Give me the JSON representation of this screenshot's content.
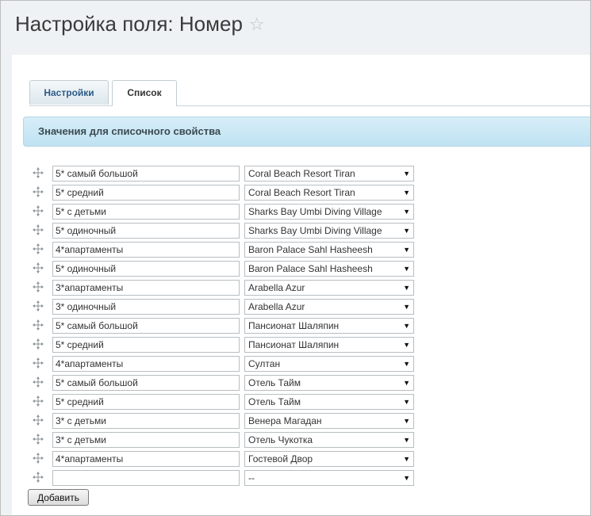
{
  "page": {
    "title": "Настройка поля: Номер"
  },
  "tabs": [
    {
      "label": "Настройки",
      "active": false
    },
    {
      "label": "Список",
      "active": true
    }
  ],
  "section": {
    "title": "Значения для списочного свойства"
  },
  "rows": [
    {
      "value": "5* самый большой",
      "hotel": "Coral Beach Resort Tiran"
    },
    {
      "value": "5* средний",
      "hotel": "Coral Beach Resort Tiran"
    },
    {
      "value": "5* с детьми",
      "hotel": "Sharks Bay Umbi Diving Village"
    },
    {
      "value": "5* одиночный",
      "hotel": "Sharks Bay Umbi Diving Village"
    },
    {
      "value": "4*апартаменты",
      "hotel": "Baron Palace Sahl Hasheesh"
    },
    {
      "value": "5* одиночный",
      "hotel": "Baron Palace Sahl Hasheesh"
    },
    {
      "value": "3*апартаменты",
      "hotel": "Arabella Azur"
    },
    {
      "value": "3* одиночный",
      "hotel": "Arabella Azur"
    },
    {
      "value": "5* самый большой",
      "hotel": "Пансионат Шаляпин"
    },
    {
      "value": "5* средний",
      "hotel": "Пансионат Шаляпин"
    },
    {
      "value": "4*апартаменты",
      "hotel": "Султан"
    },
    {
      "value": "5* самый большой",
      "hotel": "Отель Тайм"
    },
    {
      "value": "5* средний",
      "hotel": "Отель Тайм"
    },
    {
      "value": "3* с детьми",
      "hotel": "Венера Магадан"
    },
    {
      "value": "3* с детьми",
      "hotel": "Отель Чукотка"
    },
    {
      "value": "4*апартаменты",
      "hotel": "Гостевой Двор"
    },
    {
      "value": "",
      "hotel": "--"
    }
  ],
  "buttons": {
    "add_label": "Добавить"
  }
}
